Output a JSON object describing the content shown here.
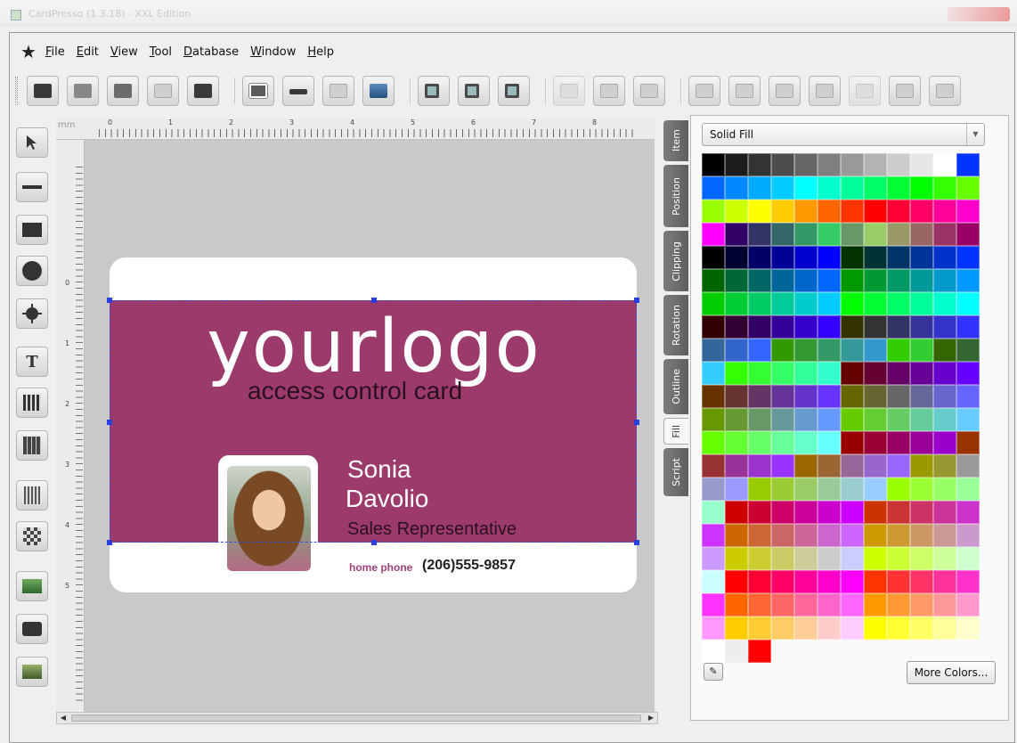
{
  "window": {
    "title": "CardPresso (1.3.18) - XXL Edition"
  },
  "menu": [
    "File",
    "Edit",
    "View",
    "Tool",
    "Database",
    "Window",
    "Help"
  ],
  "toolbar_groups": [
    [
      "new-card-icon",
      "open-card-icon",
      "save-card-icon",
      "settings-icon",
      "print-icon"
    ],
    [
      "card-view-icon",
      "magstripe-icon",
      "grid-icon",
      "card-design-icon"
    ],
    [
      "zoom-in-icon",
      "zoom-out-icon",
      "zoom-fit-icon"
    ],
    [
      "export-icon",
      "import-icon",
      "refresh-icon"
    ],
    [
      "bring-front-icon",
      "send-back-icon",
      "move-up-icon",
      "move-down-icon",
      "align-icon",
      "add-item-icon",
      "remove-item-icon"
    ]
  ],
  "tools": [
    "pointer",
    "line",
    "rectangle",
    "ellipse",
    "star-shape",
    "text",
    "barcode-text",
    "calendar",
    "barcode",
    "qrcode",
    "image",
    "camera",
    "picture"
  ],
  "ruler": {
    "unit": "mm",
    "top_numbers": [
      "0",
      "1",
      "2",
      "3",
      "4",
      "5",
      "6",
      "7",
      "8"
    ],
    "left_numbers": [
      "0",
      "1",
      "2",
      "3",
      "4",
      "5"
    ]
  },
  "card": {
    "logo": "yourlogo",
    "subtitle": "access control card",
    "first_name": "Sonia",
    "last_name": "Davolio",
    "role": "Sales Representative",
    "phone_label": "home phone",
    "phone": "(206)555-9857",
    "band_color": "#9c3a6c"
  },
  "tabs": [
    "Item",
    "Position",
    "Clipping",
    "Rotation",
    "Outline",
    "Fill",
    "Script"
  ],
  "active_tab": "Fill",
  "fill": {
    "mode": "Solid Fill",
    "more_colors_label": "More Colors...",
    "swatches": [
      "#000000",
      "#1c1c1c",
      "#333333",
      "#4d4d4d",
      "#666666",
      "#808080",
      "#999999",
      "#b3b3b3",
      "#cccccc",
      "#e6e6e6",
      "#ffffff",
      "#0033ff",
      "#0066ff",
      "#0088ff",
      "#00aaff",
      "#00ccff",
      "#00ffff",
      "#00ffcc",
      "#00ff99",
      "#00ff66",
      "#00ff33",
      "#00ff00",
      "#33ff00",
      "#66ff00",
      "#99ff00",
      "#ccff00",
      "#ffff00",
      "#ffcc00",
      "#ff9900",
      "#ff6600",
      "#ff3300",
      "#ff0000",
      "#ff0033",
      "#ff0066",
      "#ff0099",
      "#ff00cc",
      "#ff00ff",
      "#330066",
      "#333366",
      "#336666",
      "#339966",
      "#33cc66",
      "#669966",
      "#99cc66",
      "#999966",
      "#996666",
      "#993366",
      "#990066",
      "#000000",
      "#000033",
      "#000066",
      "#000099",
      "#0000cc",
      "#0000ff",
      "#003300",
      "#003333",
      "#003366",
      "#003399",
      "#0033cc",
      "#0033ff",
      "#006600",
      "#006633",
      "#006666",
      "#006699",
      "#0066cc",
      "#0066ff",
      "#009900",
      "#009933",
      "#009966",
      "#009999",
      "#0099cc",
      "#0099ff",
      "#00cc00",
      "#00cc33",
      "#00cc66",
      "#00cc99",
      "#00cccc",
      "#00ccff",
      "#00ff00",
      "#00ff33",
      "#00ff66",
      "#00ff99",
      "#00ffcc",
      "#00ffff",
      "#330000",
      "#330033",
      "#330066",
      "#330099",
      "#3300cc",
      "#3300ff",
      "#333300",
      "#333333",
      "#333366",
      "#333399",
      "#3333cc",
      "#3333ff",
      "#336699",
      "#3366cc",
      "#3366ff",
      "#339900",
      "#339933",
      "#339966",
      "#339999",
      "#3399cc",
      "#33cc00",
      "#33cc33",
      "#336600",
      "#336633",
      "#33ccff",
      "#33ff00",
      "#33ff33",
      "#33ff66",
      "#33ff99",
      "#33ffcc",
      "#660000",
      "#660033",
      "#660066",
      "#660099",
      "#6600cc",
      "#6600ff",
      "#663300",
      "#663333",
      "#663366",
      "#663399",
      "#6633cc",
      "#6633ff",
      "#666600",
      "#666633",
      "#666666",
      "#666699",
      "#6666cc",
      "#6666ff",
      "#669900",
      "#669933",
      "#669966",
      "#669999",
      "#6699cc",
      "#6699ff",
      "#66cc00",
      "#66cc33",
      "#66cc66",
      "#66cc99",
      "#66cccc",
      "#66ccff",
      "#66ff00",
      "#66ff33",
      "#66ff66",
      "#66ff99",
      "#66ffcc",
      "#66ffff",
      "#990000",
      "#990033",
      "#990066",
      "#990099",
      "#9900cc",
      "#993300",
      "#993333",
      "#993399",
      "#9933cc",
      "#9933ff",
      "#996600",
      "#996633",
      "#996699",
      "#9966cc",
      "#9966ff",
      "#999900",
      "#999933",
      "#999999",
      "#9999cc",
      "#9999ff",
      "#99cc00",
      "#99cc33",
      "#99cc66",
      "#99cc99",
      "#99cccc",
      "#99ccff",
      "#99ff00",
      "#99ff33",
      "#99ff66",
      "#99ff99",
      "#99ffcc",
      "#cc0000",
      "#cc0033",
      "#cc0066",
      "#cc0099",
      "#cc00cc",
      "#cc00ff",
      "#cc3300",
      "#cc3333",
      "#cc3366",
      "#cc3399",
      "#cc33cc",
      "#cc33ff",
      "#cc6600",
      "#cc6633",
      "#cc6666",
      "#cc6699",
      "#cc66cc",
      "#cc66ff",
      "#cc9900",
      "#cc9933",
      "#cc9966",
      "#cc9999",
      "#cc99cc",
      "#cc99ff",
      "#cccc00",
      "#cccc33",
      "#cccc66",
      "#cccc99",
      "#cccccc",
      "#ccccff",
      "#ccff00",
      "#ccff33",
      "#ccff66",
      "#ccff99",
      "#ccffcc",
      "#ccffff",
      "#ff0000",
      "#ff0033",
      "#ff0066",
      "#ff0099",
      "#ff00cc",
      "#ff00ff",
      "#ff3300",
      "#ff3333",
      "#ff3366",
      "#ff3399",
      "#ff33cc",
      "#ff33ff",
      "#ff6600",
      "#ff6633",
      "#ff6666",
      "#ff6699",
      "#ff66cc",
      "#ff66ff",
      "#ff9900",
      "#ff9933",
      "#ff9966",
      "#ff9999",
      "#ff99cc",
      "#ff99ff",
      "#ffcc00",
      "#ffcc33",
      "#ffcc66",
      "#ffcc99",
      "#ffcccc",
      "#ffccff",
      "#ffff00",
      "#ffff33",
      "#ffff66",
      "#ffff99",
      "#ffffcc",
      "#ffffff",
      "#eeeeee",
      "#ff0000"
    ]
  }
}
